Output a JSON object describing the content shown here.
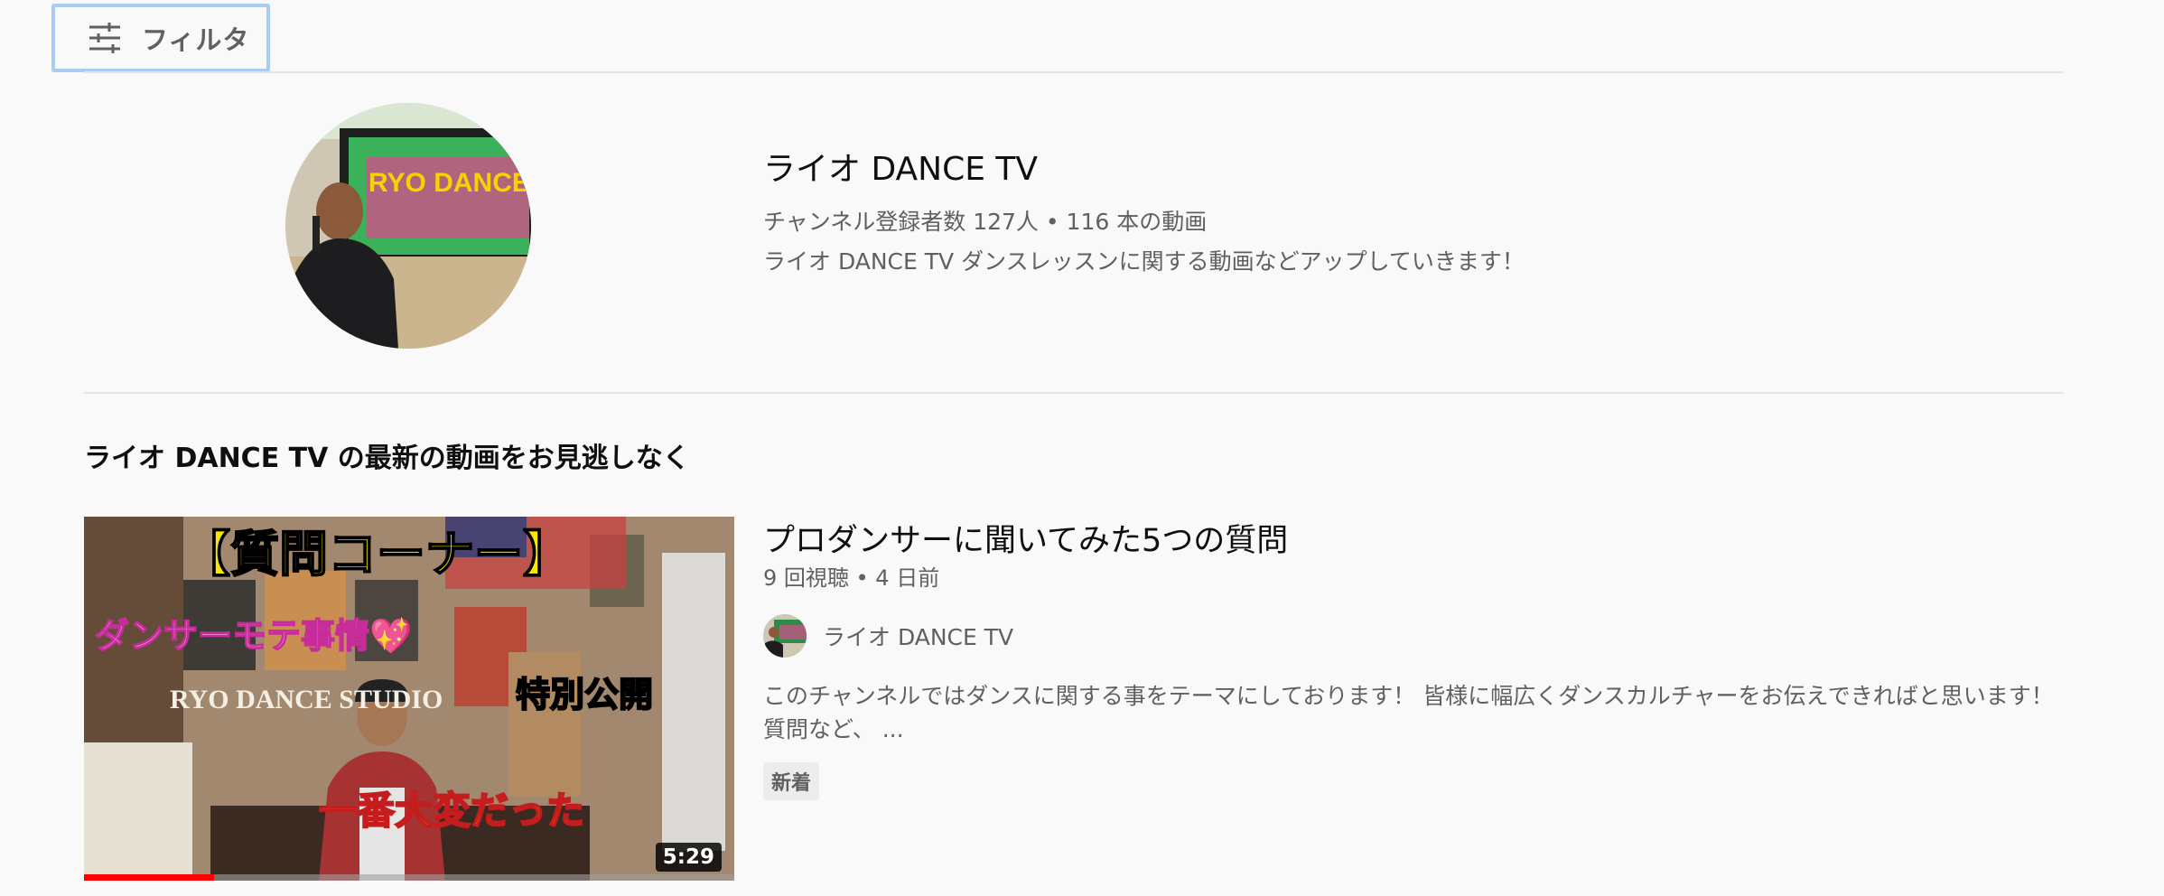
{
  "filter": {
    "label": "フィルタ",
    "icon": "sliders-icon"
  },
  "channel": {
    "name": "ライオ DANCE TV",
    "meta": "チャンネル登録者数 127人 • 116 本の動画",
    "description": "ライオ DANCE TV ダンスレッスンに関する動画などアップしていきます！",
    "avatar_text": "RYO DANCE STUDIO"
  },
  "section": {
    "title": "ライオ DANCE TV の最新の動画をお見逃しなく"
  },
  "video": {
    "title": "プロダンサーに聞いてみた5つの質問",
    "meta": "9 回視聴 • 4 日前",
    "channel_name": "ライオ DANCE TV",
    "description": "このチャンネルではダンスに関する事をテーマにしております！ 皆様に幅広くダンスカルチャーをお伝えできればと思います！ 質問など、 ...",
    "badge": "新着",
    "duration": "5:29",
    "watched_progress": 0.2,
    "thumbnail_texts": {
      "headline": "【質問コーナー】",
      "left": "ダンサーモテ事情💖",
      "right": "特別公開",
      "bottom": "一番大変だった",
      "studio": "RYO DANCE STUDIO"
    }
  },
  "colors": {
    "background": "#f9f9f9",
    "focus_ring": "#a9cdf1",
    "progress": "#ff0000",
    "secondary_text": "#606060"
  }
}
